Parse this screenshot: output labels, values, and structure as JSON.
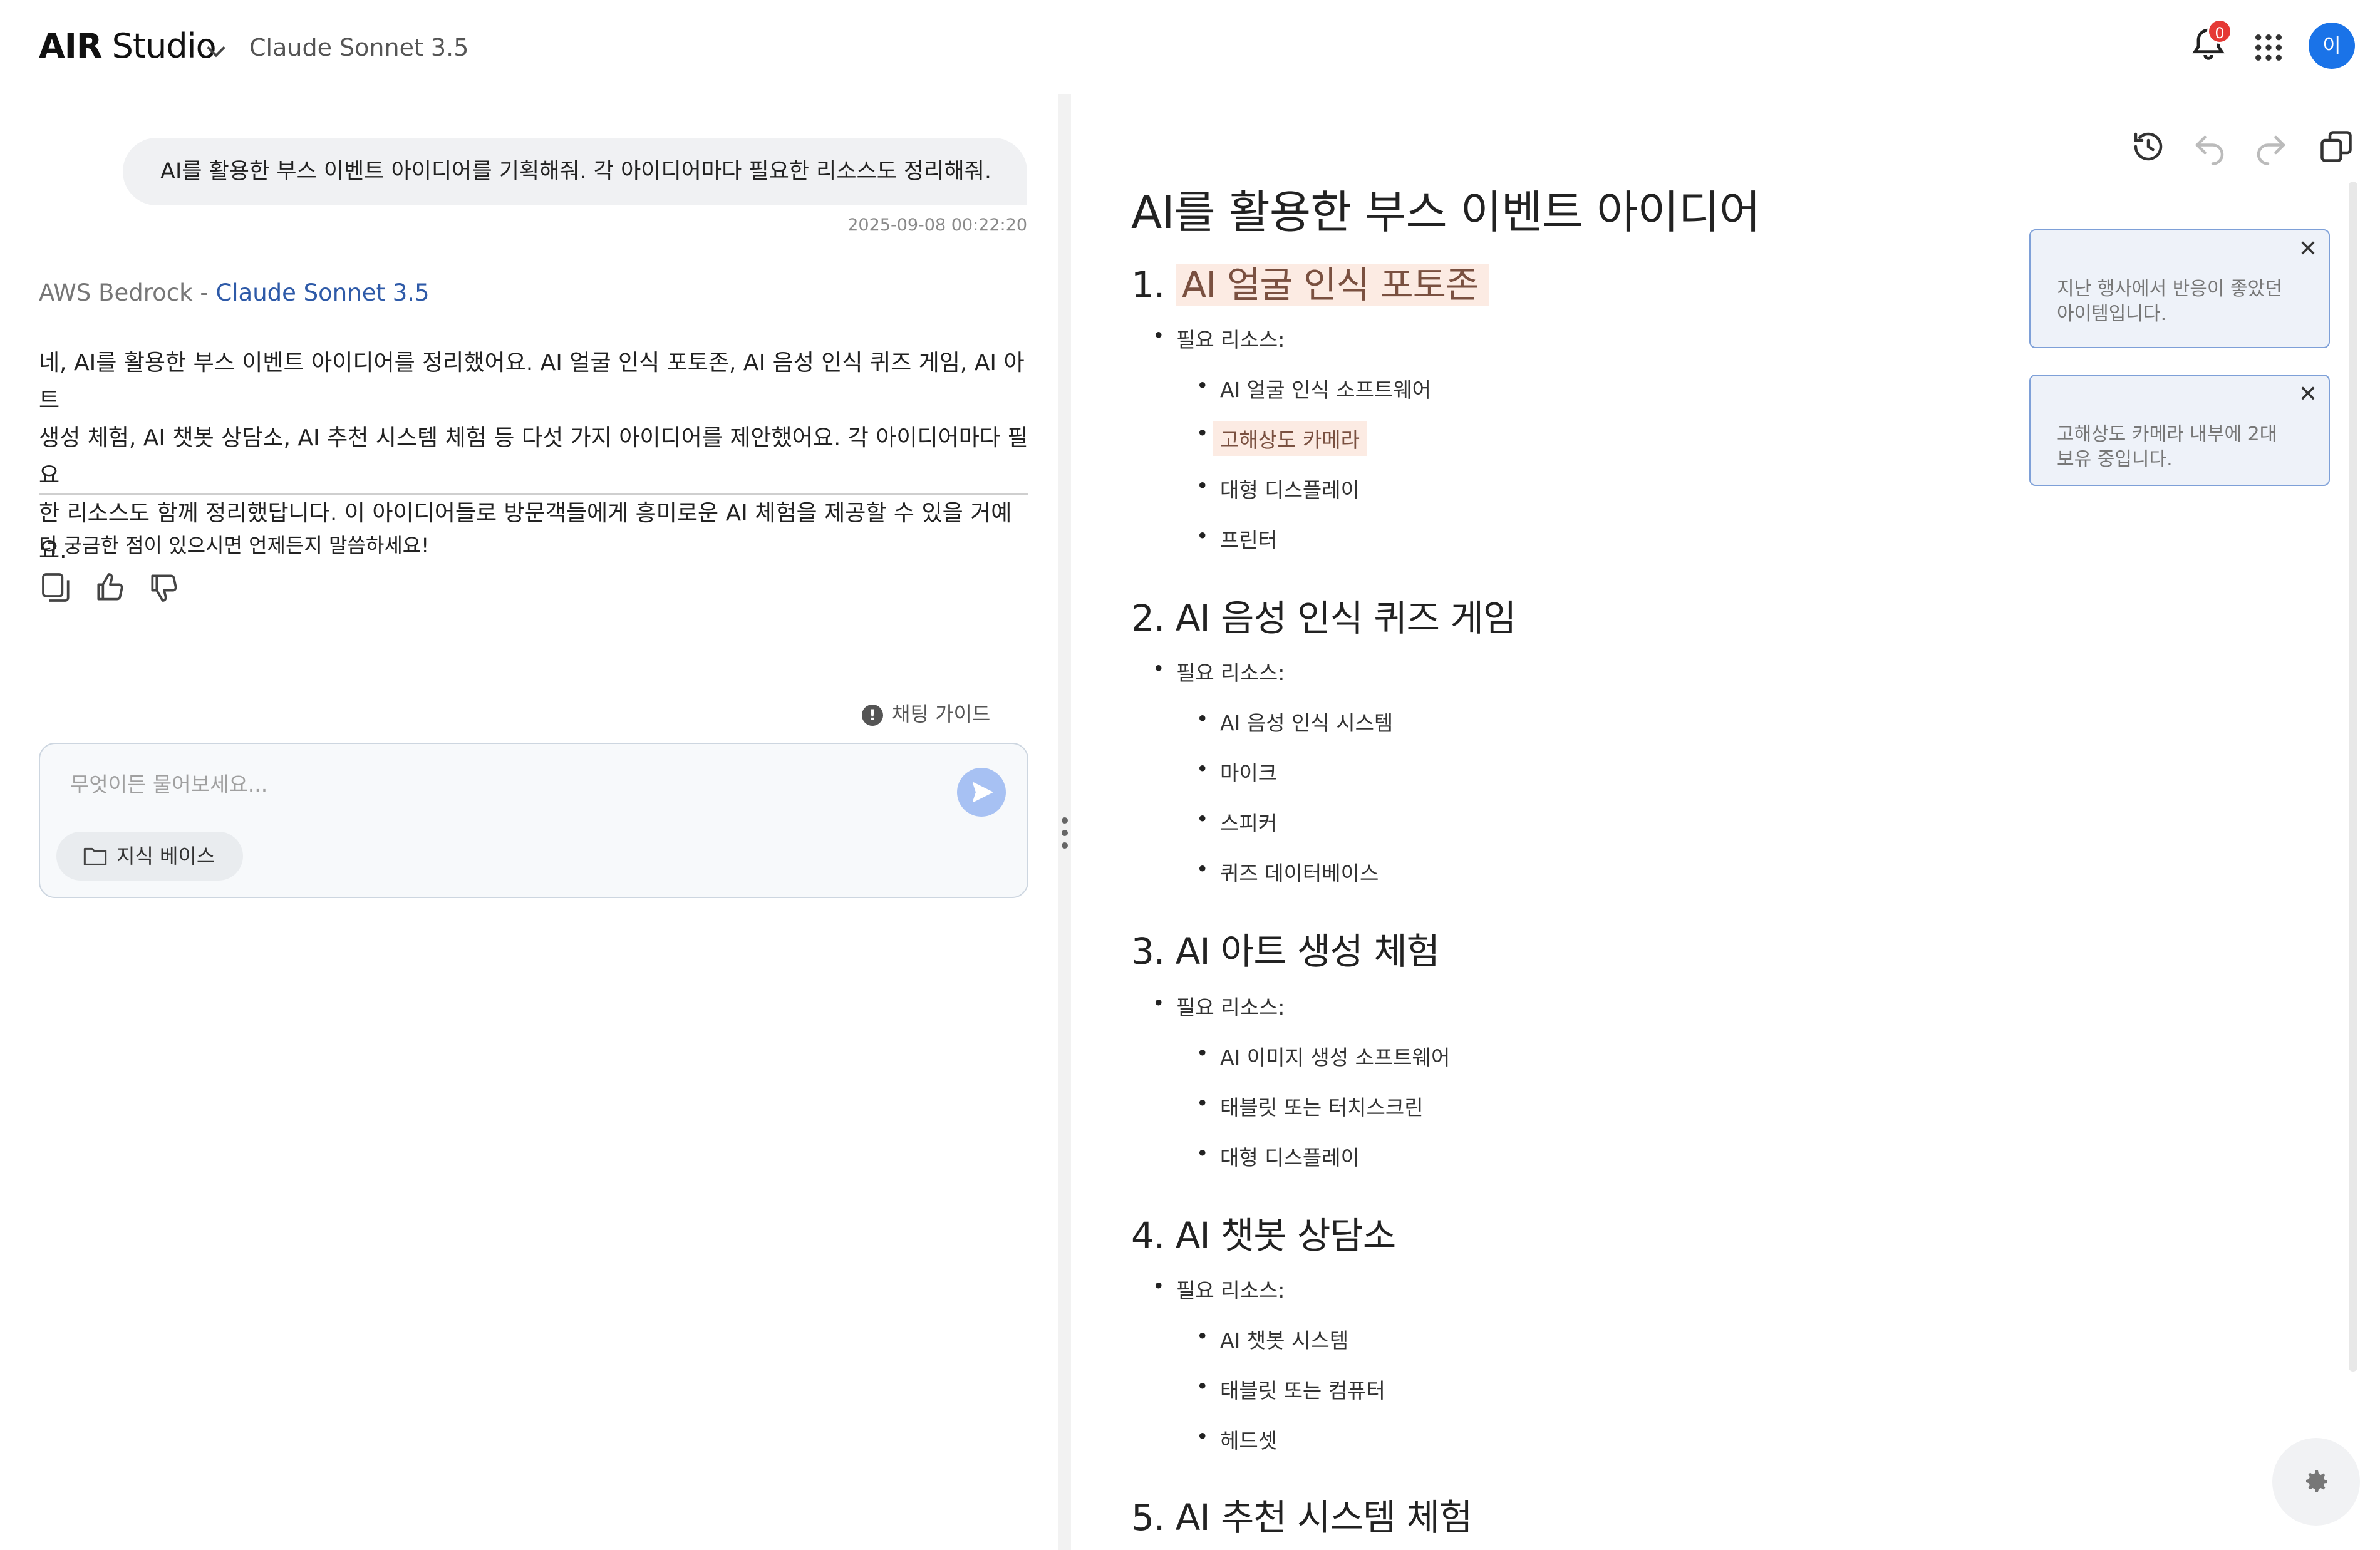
{
  "header": {
    "logo_bold": "AIR",
    "logo_light": "Studio",
    "model_name": "Claude Sonnet 3.5",
    "notification_count": "0",
    "avatar_initial": "이"
  },
  "chat": {
    "user_message": "AI를 활용한 부스 이벤트 아이디어를 기획해줘. 각 아이디어마다 필요한 리소스도 정리해줘.",
    "user_timestamp": "2025-09-08 00:22:20",
    "source_provider": "AWS Bedrock",
    "source_sep": " - ",
    "source_model": "Claude Sonnet 3.5",
    "answer_lines": [
      "네, AI를 활용한 부스 이벤트 아이디어를 정리했어요. AI 얼굴 인식 포토존, AI 음성 인식 퀴즈 게임, AI 아트",
      "생성 체험, AI 챗봇 상담소, AI 추천 시스템 체험 등 다섯 가지 아이디어를 제안했어요. 각 아이디어마다 필요",
      "한 리소스도 함께 정리했답니다. 이 아이디어들로 방문객들에게 흥미로운 AI 체험을 제공할 수 있을 거예요."
    ],
    "follow_up": "더 궁금한 점이 있으시면 언제든지 말씀하세요!",
    "guide_label": "채팅 가이드",
    "input_placeholder": "무엇이든 물어보세요...",
    "knowledge_base_label": "지식 베이스"
  },
  "document": {
    "title": "AI를 활용한 부스 이벤트 아이디어",
    "resource_label": "필요 리소스:",
    "sections": [
      {
        "num": "1. ",
        "heading": "AI 얼굴 인식 포토존",
        "items": [
          "AI 얼굴 인식 소프트웨어",
          "고해상도 카메라",
          "대형 디스플레이",
          "프린터"
        ]
      },
      {
        "num": "2. ",
        "heading": "AI 음성 인식 퀴즈 게임",
        "items": [
          "AI 음성 인식 시스템",
          "마이크",
          "스피커",
          "퀴즈 데이터베이스"
        ]
      },
      {
        "num": "3. ",
        "heading": "AI 아트 생성 체험",
        "items": [
          "AI 이미지 생성 소프트웨어",
          "태블릿 또는 터치스크린",
          "대형 디스플레이"
        ]
      },
      {
        "num": "4. ",
        "heading": "AI 챗봇 상담소",
        "items": [
          "AI 챗봇 시스템",
          "태블릿 또는 컴퓨터",
          "헤드셋"
        ]
      },
      {
        "num": "5. ",
        "heading": "AI 추천 시스템 체험",
        "items": []
      }
    ],
    "comments": [
      {
        "text_line1": "지난 행사에서 반응이 좋았던",
        "text_line2": "아이템입니다."
      },
      {
        "text_line1": "고해상도 카메라 내부에 2대",
        "text_line2": "보유 중입니다."
      }
    ]
  },
  "colors": {
    "accent_blue": "#1a73e8",
    "highlight_bg": "#fcebe3",
    "comment_border": "#7ea0d8",
    "badge_red": "#e53935"
  },
  "icons": [
    "chevron-down-icon",
    "bell-icon",
    "apps-grid-icon",
    "copy-icon",
    "thumbs-up-icon",
    "thumbs-down-icon",
    "info-icon",
    "send-icon",
    "folder-icon",
    "history-icon",
    "undo-icon",
    "redo-icon",
    "duplicate-icon",
    "close-icon",
    "gear-icon",
    "drag-handle-icon"
  ]
}
